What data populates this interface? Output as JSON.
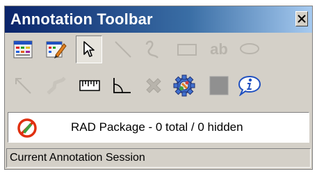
{
  "window": {
    "title": "Annotation Toolbar",
    "close_label": "×"
  },
  "toolbar": {
    "row1": [
      {
        "name": "annotation-list-icon",
        "enabled": true
      },
      {
        "name": "edit-annotation-icon",
        "enabled": true
      },
      {
        "name": "select-pointer-icon",
        "enabled": true,
        "pressed": true
      },
      {
        "name": "line-tool-icon",
        "enabled": false
      },
      {
        "name": "freehand-tool-icon",
        "enabled": false
      },
      {
        "name": "rectangle-tool-icon",
        "enabled": false
      },
      {
        "name": "text-tool-icon",
        "enabled": false,
        "text": "ab"
      },
      {
        "name": "ellipse-tool-icon",
        "enabled": false
      }
    ],
    "row2": [
      {
        "name": "arrow-tool-icon",
        "enabled": false
      },
      {
        "name": "polyline-tool-icon",
        "enabled": false
      },
      {
        "name": "ruler-tool-icon",
        "enabled": false
      },
      {
        "name": "angle-tool-icon",
        "enabled": false
      },
      {
        "name": "delete-annotation-icon",
        "enabled": false
      },
      {
        "name": "settings-gear-icon",
        "enabled": true
      },
      {
        "name": "fill-color-icon",
        "enabled": false
      },
      {
        "name": "info-icon",
        "enabled": true
      }
    ]
  },
  "status": {
    "text": "RAD Package - 0 total / 0 hidden",
    "icon": "no-edit-icon"
  },
  "session": {
    "text": "Current Annotation Session"
  },
  "colors": {
    "title_gradient_start": "#0a246a",
    "title_gradient_end": "#a6caf0",
    "window_bg": "#d4d0c8",
    "disabled_gray": "#b8b4ac"
  }
}
